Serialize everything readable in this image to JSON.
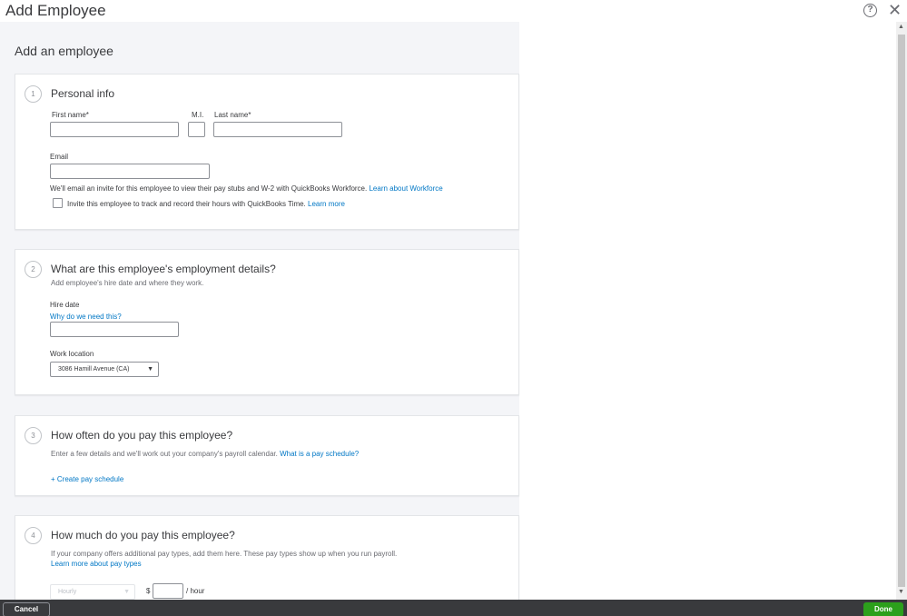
{
  "window": {
    "title": "Add Employee"
  },
  "icons": {
    "help": "?",
    "close": "✕",
    "scroll_up": "▲",
    "scroll_down": "▼",
    "caret": "▼"
  },
  "page": {
    "heading": "Add an employee"
  },
  "personal_info": {
    "step": "1",
    "title": "Personal info",
    "first_name_label": "First name*",
    "mi_label": "M.I.",
    "last_name_label": "Last name*",
    "email_label": "Email",
    "email_note": "We'll email an invite for this employee to view their pay stubs and W-2 with QuickBooks Workforce.",
    "email_note_link": "Learn about Workforce",
    "invite_text": "Invite this employee to track and record their hours with QuickBooks Time.",
    "invite_link": "Learn more"
  },
  "employment": {
    "step": "2",
    "title": "What are this employee's employment details?",
    "subtitle": "Add employee's hire date and where they work.",
    "hire_date_label": "Hire date",
    "hire_date_link": "Why do we need this?",
    "work_location_label": "Work location",
    "work_location_value": "3086 Hamill Avenue (CA)"
  },
  "pay_schedule": {
    "step": "3",
    "title": "How often do you pay this employee?",
    "description": "Enter a few details and we'll work out your company's payroll calendar.",
    "description_link": "What is a pay schedule?",
    "create_link": "+ Create pay schedule"
  },
  "pay_rate": {
    "step": "4",
    "title": "How much do you pay this employee?",
    "description": "If your company offers additional pay types, add them here. These pay types show up when you run payroll.",
    "learn_link": "Learn more about pay types",
    "pay_type_value": "Hourly",
    "currency": "$",
    "unit": "/ hour"
  },
  "footer": {
    "cancel_label": "Cancel",
    "done_label": "Done"
  }
}
